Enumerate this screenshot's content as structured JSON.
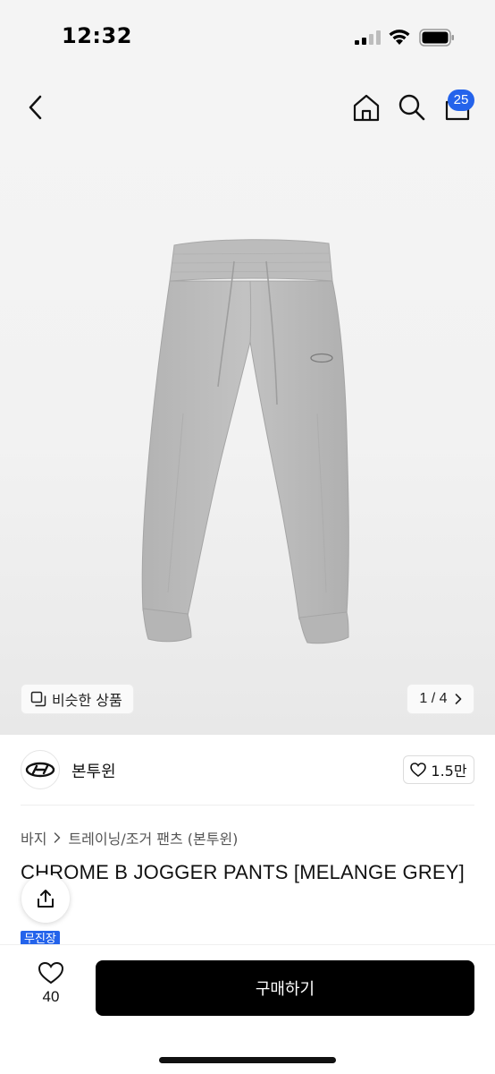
{
  "status_bar": {
    "time": "12:32"
  },
  "nav": {
    "cart_count": "25"
  },
  "hero": {
    "similar_label": "비슷한 상품",
    "page_indicator": "1 / 4"
  },
  "brand": {
    "name": "본투윈",
    "likes": "1.5만"
  },
  "breadcrumb": {
    "level1": "바지",
    "level2": "트레이닝/조거 팬츠 (본투윈)"
  },
  "product": {
    "title": "CHROME B JOGGER PANTS [MELANGE GREY]",
    "badge": "무진장"
  },
  "bottom_bar": {
    "wish_count": "40",
    "buy_label": "구매하기"
  },
  "colors": {
    "accent": "#2463eb",
    "buy_button": "#000000",
    "pants": "#bdbdbd"
  }
}
